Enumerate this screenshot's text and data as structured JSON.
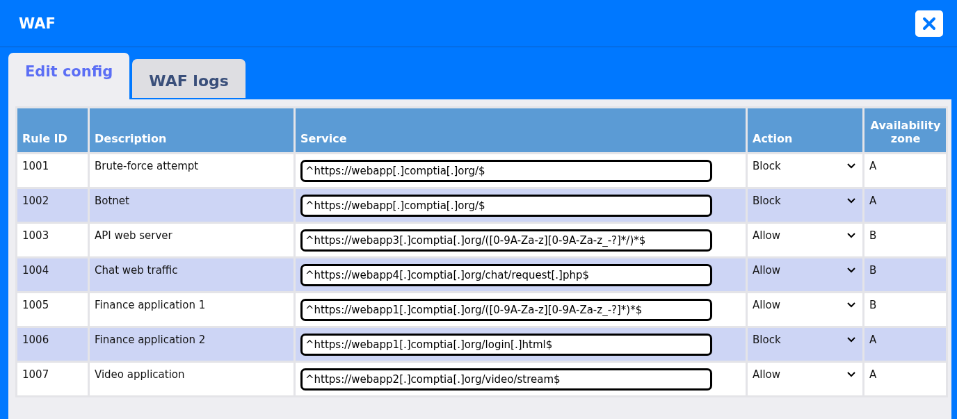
{
  "window": {
    "title": "WAF"
  },
  "tabs": [
    {
      "label": "Edit config",
      "selected": true
    },
    {
      "label": "WAF logs",
      "selected": false
    }
  ],
  "table": {
    "columns": [
      "Rule ID",
      "Description",
      "Service",
      "Action",
      "Availability zone"
    ],
    "rows": [
      {
        "rule_id": "1001",
        "description": "Brute-force attempt",
        "service": "^https://webapp[.]comptia[.]org/$",
        "action": "Block",
        "zone": "A"
      },
      {
        "rule_id": "1002",
        "description": "Botnet",
        "service": "^https://webapp[.]comptia[.]org/$",
        "action": "Block",
        "zone": "A"
      },
      {
        "rule_id": "1003",
        "description": "API web server",
        "service": "^https://webapp3[.]comptia[.]org/([0-9A-Za-z][0-9A-Za-z_-?]*/)*$",
        "action": "Allow",
        "zone": "B"
      },
      {
        "rule_id": "1004",
        "description": "Chat web traffic",
        "service": "^https://webapp4[.]comptia[.]org/chat/request[.]php$",
        "action": "Allow",
        "zone": "B"
      },
      {
        "rule_id": "1005",
        "description": "Finance application 1",
        "service": "^https://webapp1[.]comptia[.]org/([0-9A-Za-z][0-9A-Za-z_-?]*)*$",
        "action": "Allow",
        "zone": "B"
      },
      {
        "rule_id": "1006",
        "description": "Finance application 2",
        "service": "^https://webapp1[.]comptia[.]org/login[.]html$",
        "action": "Block",
        "zone": "A"
      },
      {
        "rule_id": "1007",
        "description": "Video application",
        "service": "^https://webapp2[.]comptia[.]org/video/stream$",
        "action": "Allow",
        "zone": "A"
      }
    ]
  }
}
